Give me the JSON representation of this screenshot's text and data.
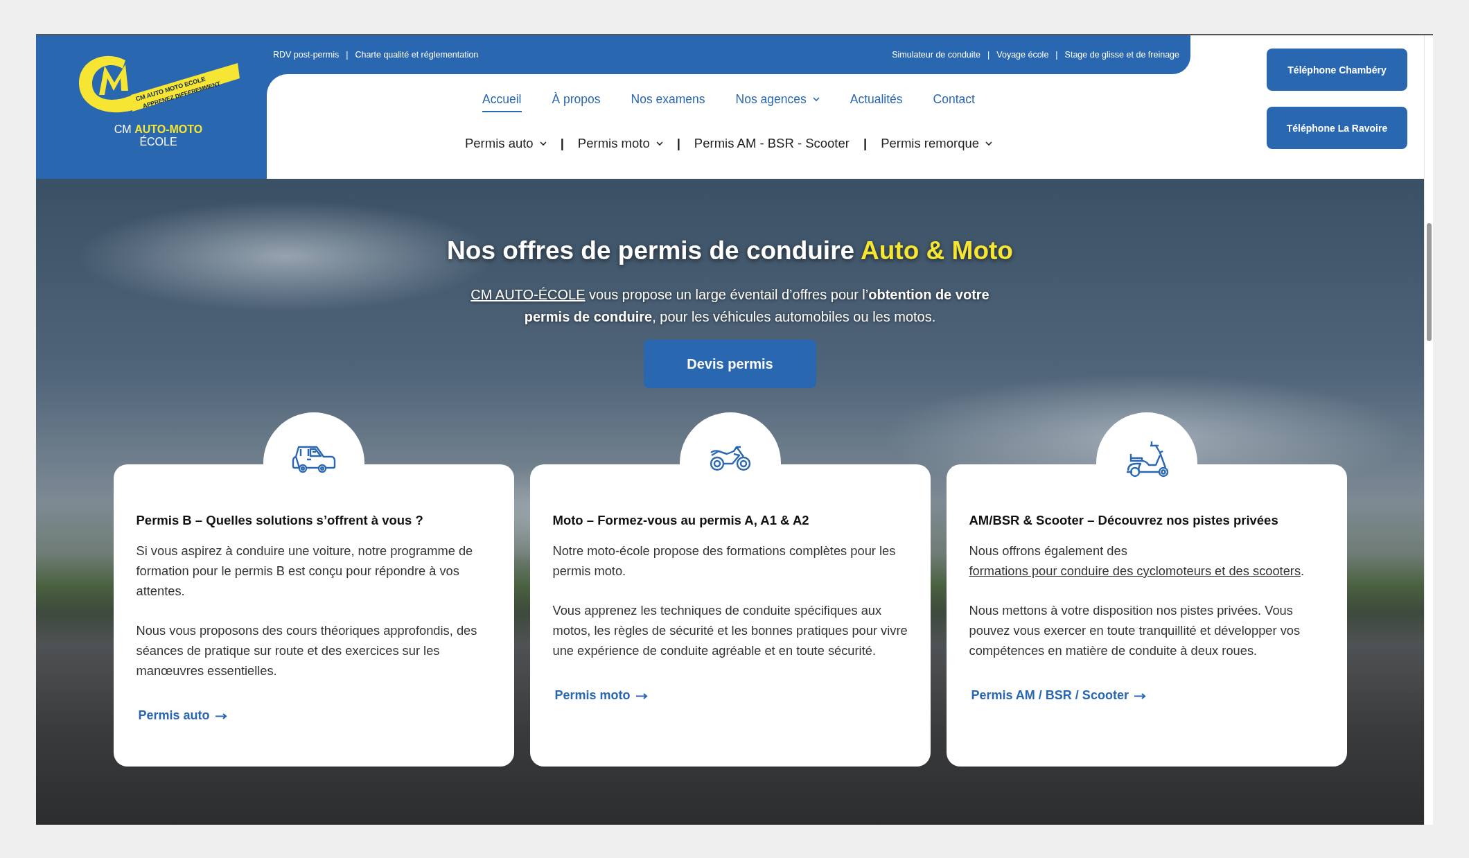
{
  "logo": {
    "badge_text": "CM AUTO MOTO ECOLE",
    "slogan": "APPRENEZ DIFFEREMMENT",
    "name": "CM **AUTO-MOTO**",
    "subname": "ÉCOLE"
  },
  "top_bar": {
    "separator": "|",
    "left_links": [
      "RDV post-permis",
      "Charte qualité et réglementation"
    ],
    "right_links": [
      "Simulateur de conduite",
      "Voyage école",
      "Stage de glisse et de freinage"
    ]
  },
  "main_nav": [
    {
      "label": "Accueil",
      "selected": true,
      "dropdown": false
    },
    {
      "label": "À propos",
      "selected": false,
      "dropdown": false
    },
    {
      "label": "Nos examens",
      "selected": false,
      "dropdown": false
    },
    {
      "label": "Nos agences",
      "selected": false,
      "dropdown": true
    },
    {
      "label": "Actualités",
      "selected": false,
      "dropdown": false
    },
    {
      "label": "Contact",
      "selected": false,
      "dropdown": false
    }
  ],
  "sub_nav": {
    "separator": "|",
    "items": [
      {
        "label": "Permis auto",
        "dropdown": true
      },
      {
        "label": "Permis moto",
        "dropdown": true
      },
      {
        "label": "Permis AM - BSR - Scooter",
        "dropdown": false
      },
      {
        "label": "Permis remorque",
        "dropdown": true
      }
    ]
  },
  "phone_buttons": [
    "Téléphone Chambéry",
    "Téléphone La Ravoire"
  ],
  "hero": {
    "title": "Nos offres de permis de conduire",
    "title_highlight": "Auto & Moto",
    "intro_link": "CM AUTO-ÉCOLE",
    "intro": " vous propose un large éventail d’offres pour l’**obtention de votre permis de conduire**, pour les véhicules automobiles ou les motos.",
    "button": "Devis permis"
  },
  "cards": [
    {
      "kind": "car",
      "title": "Permis B – Quelles solutions s’offrent à vous ?",
      "paragraphs": [
        {
          "text": "Si vous aspirez à conduire une voiture, notre programme de formation pour le permis B est conçu pour répondre à vos attentes."
        },
        {
          "text": "Nous vous proposons des cours théoriques approfondis, des séances de pratique sur route et des exercices sur les manœuvres essentielles."
        }
      ],
      "link": "Permis auto"
    },
    {
      "kind": "motorcycle",
      "title": "Moto – Formez-vous au permis A, A1 & A2",
      "paragraphs": [
        {
          "text": "Notre moto-école propose des formations complètes pour les permis moto."
        },
        {
          "text": "Vous apprenez les techniques de conduite spécifiques aux motos, les règles de sécurité et les bonnes pratiques pour vivre une expérience de conduite agréable et en toute sécurité."
        }
      ],
      "link": "Permis moto"
    },
    {
      "kind": "scooter",
      "title": "AM/BSR & Scooter – Découvrez nos pistes privées",
      "paragraphs": [
        {
          "text": "Nous offrons également des ",
          "link": "formations pour conduire des cyclomoteurs et des scooters",
          "after": "."
        },
        {
          "text": "Nous mettons à votre disposition nos pistes privées. Vous pouvez vous exercer en toute tranquillité et développer vos compétences en matière de conduite à deux roues."
        }
      ],
      "link": "Permis AM / BSR / Scooter"
    }
  ]
}
